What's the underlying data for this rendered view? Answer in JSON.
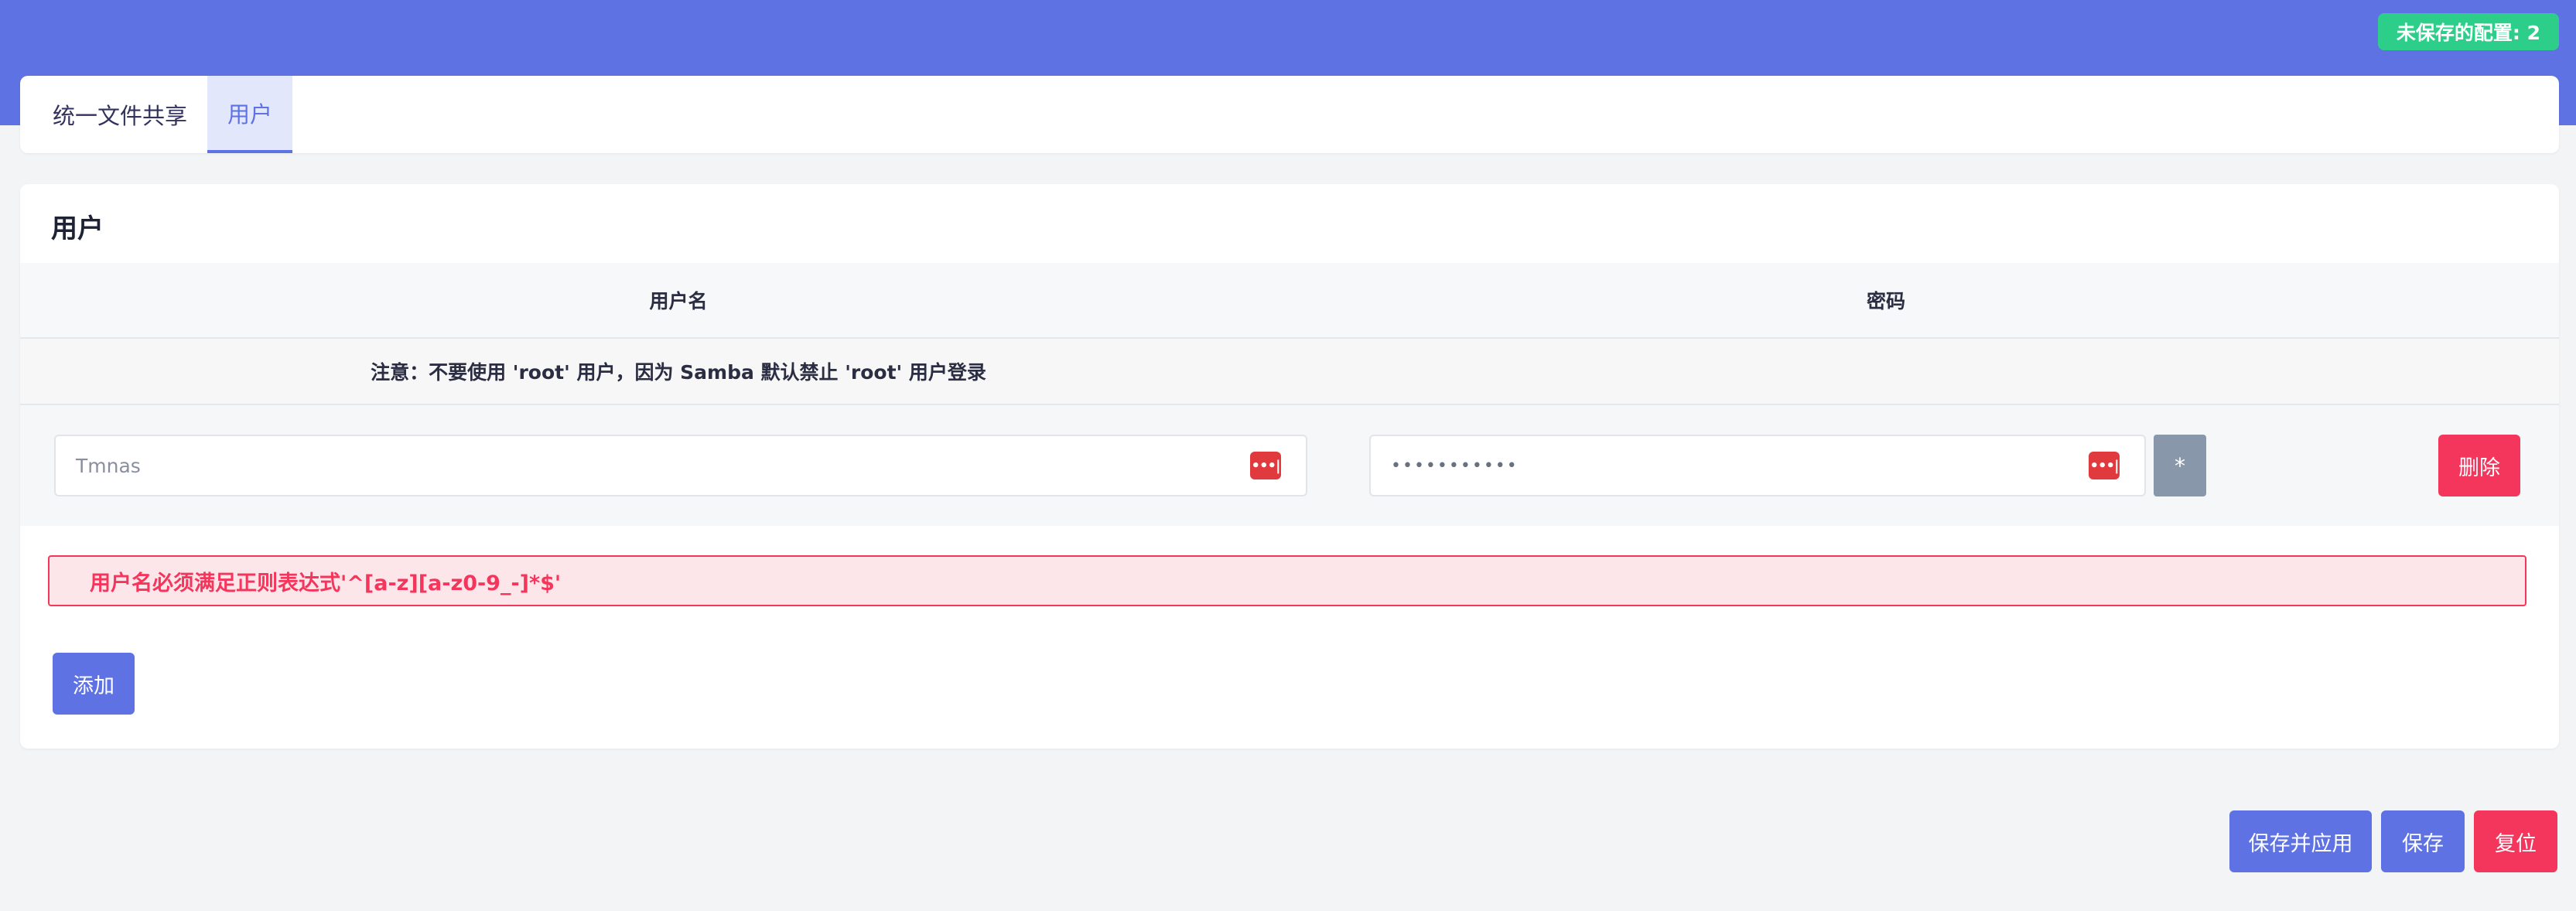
{
  "header": {
    "unsaved_badge": "未保存的配置: 2"
  },
  "tabs": [
    {
      "label": "统一文件共享",
      "active": false
    },
    {
      "label": "用户",
      "active": true
    }
  ],
  "section": {
    "title": "用户",
    "columns": {
      "username": "用户名",
      "password": "密码"
    },
    "note": "注意：不要使用 'root' 用户，因为 Samba 默认禁止 'root' 用户登录",
    "rows": [
      {
        "username_value": "Tmnas",
        "password_value": "•••••••••••",
        "password_icon": "password-manager-icon",
        "reveal_label": "*",
        "delete_label": "删除"
      }
    ],
    "error": "用户名必须满足正则表达式'^[a-z][a-z0-9_-]*$'",
    "add_label": "添加"
  },
  "footer": {
    "save_apply_label": "保存并应用",
    "save_label": "保存",
    "reset_label": "复位"
  },
  "colors": {
    "primary": "#5e72e4",
    "success": "#2dce89",
    "danger": "#f5365c",
    "neutral": "#8898aa"
  }
}
